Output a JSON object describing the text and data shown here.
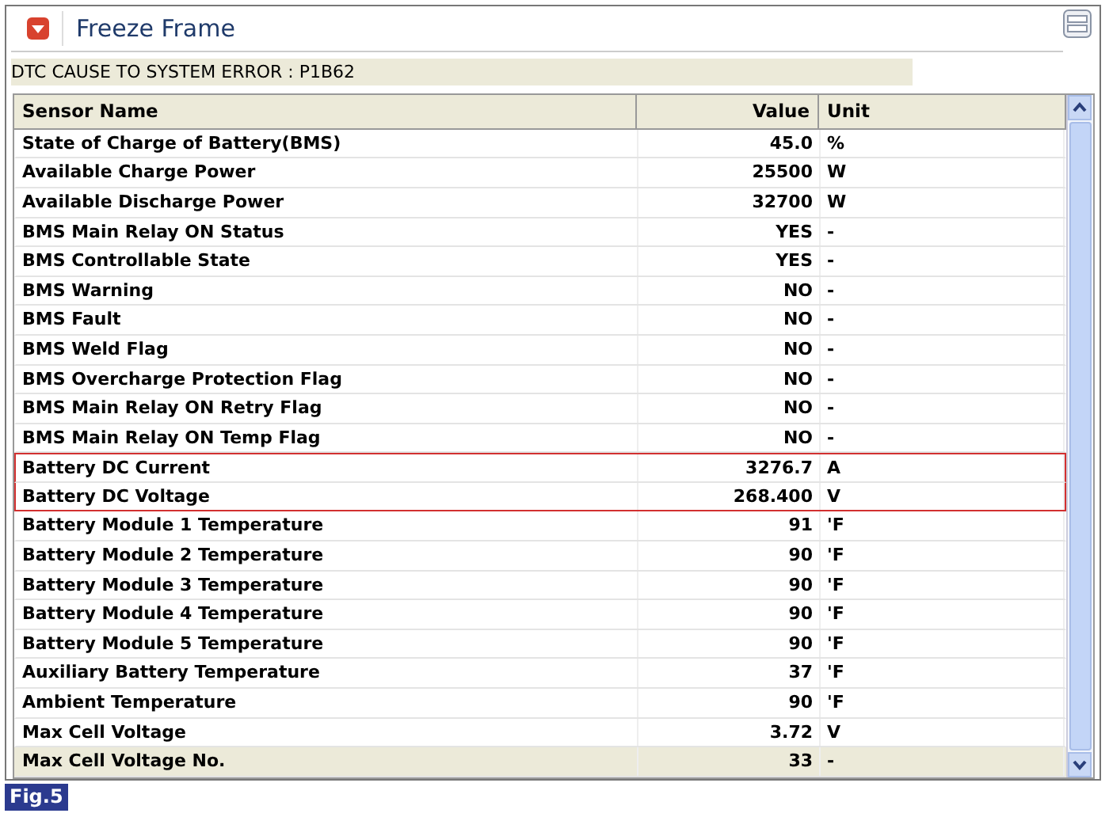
{
  "panel": {
    "title": "Freeze Frame"
  },
  "dtc_message": "DTC CAUSE TO SYSTEM ERROR : P1B62",
  "table": {
    "columns": [
      "Sensor Name",
      "Value",
      "Unit"
    ],
    "rows": [
      {
        "name": "State of Charge of Battery(BMS)",
        "value": "45.0",
        "unit": "%",
        "highlighted": false,
        "selected": false
      },
      {
        "name": "Available Charge Power",
        "value": "25500",
        "unit": "W",
        "highlighted": false,
        "selected": false
      },
      {
        "name": "Available Discharge Power",
        "value": "32700",
        "unit": "W",
        "highlighted": false,
        "selected": false
      },
      {
        "name": "BMS Main Relay ON Status",
        "value": "YES",
        "unit": "-",
        "highlighted": false,
        "selected": false
      },
      {
        "name": "BMS Controllable State",
        "value": "YES",
        "unit": "-",
        "highlighted": false,
        "selected": false
      },
      {
        "name": "BMS Warning",
        "value": "NO",
        "unit": "-",
        "highlighted": false,
        "selected": false
      },
      {
        "name": "BMS Fault",
        "value": "NO",
        "unit": "-",
        "highlighted": false,
        "selected": false
      },
      {
        "name": "BMS Weld Flag",
        "value": "NO",
        "unit": "-",
        "highlighted": false,
        "selected": false
      },
      {
        "name": "BMS Overcharge Protection Flag",
        "value": "NO",
        "unit": "-",
        "highlighted": false,
        "selected": false
      },
      {
        "name": "BMS Main Relay ON Retry Flag",
        "value": "NO",
        "unit": "-",
        "highlighted": false,
        "selected": false
      },
      {
        "name": "BMS Main Relay ON Temp Flag",
        "value": "NO",
        "unit": "-",
        "highlighted": false,
        "selected": false
      },
      {
        "name": "Battery DC Current",
        "value": "3276.7",
        "unit": "A",
        "highlighted": true,
        "selected": false
      },
      {
        "name": "Battery DC Voltage",
        "value": "268.400",
        "unit": "V",
        "highlighted": true,
        "selected": false
      },
      {
        "name": "Battery Module 1 Temperature",
        "value": "91",
        "unit": "'F",
        "highlighted": false,
        "selected": false
      },
      {
        "name": "Battery Module 2 Temperature",
        "value": "90",
        "unit": "'F",
        "highlighted": false,
        "selected": false
      },
      {
        "name": "Battery Module 3 Temperature",
        "value": "90",
        "unit": "'F",
        "highlighted": false,
        "selected": false
      },
      {
        "name": "Battery Module 4 Temperature",
        "value": "90",
        "unit": "'F",
        "highlighted": false,
        "selected": false
      },
      {
        "name": "Battery Module 5 Temperature",
        "value": "90",
        "unit": "'F",
        "highlighted": false,
        "selected": false
      },
      {
        "name": "Auxiliary Battery Temperature",
        "value": "37",
        "unit": "'F",
        "highlighted": false,
        "selected": false
      },
      {
        "name": "Ambient Temperature",
        "value": "90",
        "unit": "'F",
        "highlighted": false,
        "selected": false
      },
      {
        "name": "Max Cell Voltage",
        "value": "3.72",
        "unit": "V",
        "highlighted": false,
        "selected": false
      },
      {
        "name": "Max Cell Voltage No.",
        "value": "33",
        "unit": "-",
        "highlighted": false,
        "selected": true
      }
    ]
  },
  "figure_label": "Fig.5"
}
